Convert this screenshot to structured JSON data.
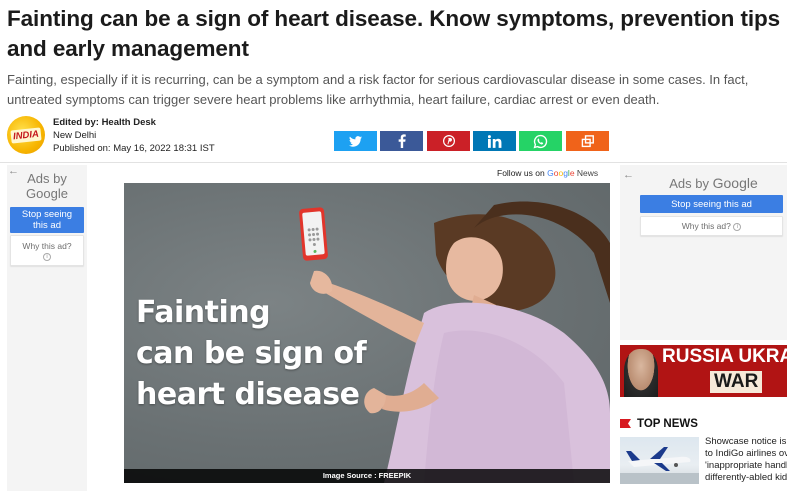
{
  "article": {
    "headline_line1": "Fainting can be a sign of heart disease. Know symptoms, prevention tips",
    "headline_line2": "and early management",
    "summary_line1": "Fainting, especially if it is recurring, can be a symptom and a risk factor for serious cardiovascular disease in some cases. In fact,",
    "summary_line2": "untreated symptoms can trigger severe heart problems like arrhythmia, heart failure, cardiac arrest or even death."
  },
  "byline": {
    "logo_text": "INDIA",
    "edited_by_label": "Edited by:",
    "editor": "Health Desk",
    "location": "New Delhi",
    "published_label": "Published on:",
    "published_date": "May 16, 2022 18:31 IST"
  },
  "share": [
    {
      "icon": "twitter-icon",
      "color": "#1da1f2"
    },
    {
      "icon": "facebook-icon",
      "color": "#3b5998"
    },
    {
      "icon": "pinterest-icon",
      "color": "#cb2027"
    },
    {
      "icon": "linkedin-icon",
      "color": "#0077b5"
    },
    {
      "icon": "whatsapp-icon",
      "color": "#25d366"
    },
    {
      "icon": "copy-link-icon",
      "color": "#f0631a"
    }
  ],
  "ads": {
    "left": {
      "back_icon": "back-arrow-icon",
      "ads_by": "Ads by",
      "google": "Google",
      "stop_line1": "Stop seeing",
      "stop_line2": "this ad",
      "why": "Why this ad?",
      "info_icon": "info-icon"
    },
    "right": {
      "back_icon": "back-arrow-icon",
      "ads_by": "Ads by",
      "google": "Google",
      "stop": "Stop seeing this ad",
      "why": "Why this ad?",
      "info_icon": "info-icon"
    }
  },
  "follow": {
    "prefix": "Follow us on",
    "google": "Google",
    "news": "News"
  },
  "hero": {
    "overlay_line1": "Fainting",
    "overlay_line2": "can be sign of",
    "overlay_line3": "heart disease",
    "caption": "Image Source : FREEPIK"
  },
  "banner": {
    "line1": "RUSSIA UKRA",
    "line2": "WAR"
  },
  "top_news": {
    "heading": "TOP NEWS",
    "flag_icon": "red-flag-icon",
    "item": {
      "line1": "Showcase notice is",
      "line2": "to IndiGo airlines ov",
      "line3": "'inappropriate handl",
      "line4": "differently-abled kid"
    }
  },
  "colors": {
    "ad_blue": "#3b7ee3",
    "banner_red": "#b11414",
    "accent_red": "#d71920"
  }
}
